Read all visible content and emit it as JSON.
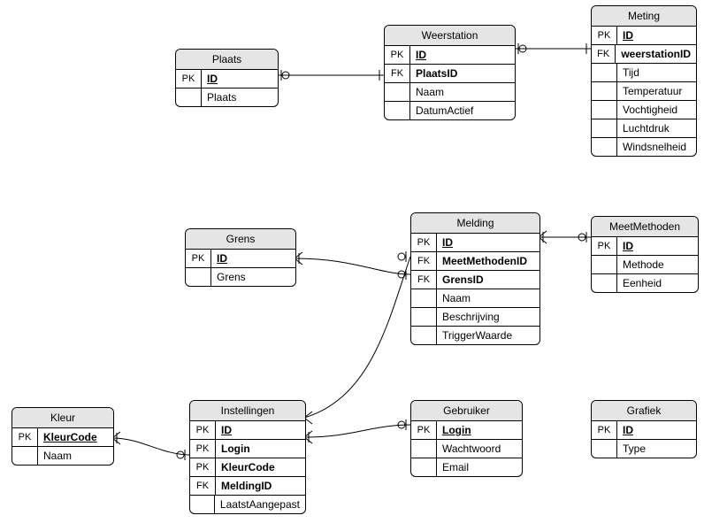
{
  "entities": {
    "plaats": {
      "title": "Plaats",
      "rows": [
        {
          "key": "PK",
          "name": "ID",
          "pk": true
        },
        {
          "key": "",
          "name": "Plaats"
        }
      ]
    },
    "weerstation": {
      "title": "Weerstation",
      "rows": [
        {
          "key": "PK",
          "name": "ID",
          "pk": true
        },
        {
          "key": "FK",
          "name": "PlaatsID",
          "fk": true
        },
        {
          "key": "",
          "name": "Naam"
        },
        {
          "key": "",
          "name": "DatumActief"
        }
      ]
    },
    "meting": {
      "title": "Meting",
      "rows": [
        {
          "key": "PK",
          "name": "ID",
          "pk": true
        },
        {
          "key": "FK",
          "name": "weerstationID",
          "fk": true
        },
        {
          "key": "",
          "name": "Tijd"
        },
        {
          "key": "",
          "name": "Temperatuur"
        },
        {
          "key": "",
          "name": "Vochtigheid"
        },
        {
          "key": "",
          "name": "Luchtdruk"
        },
        {
          "key": "",
          "name": "Windsnelheid"
        }
      ]
    },
    "grens": {
      "title": "Grens",
      "rows": [
        {
          "key": "PK",
          "name": "ID",
          "pk": true
        },
        {
          "key": "",
          "name": "Grens"
        }
      ]
    },
    "melding": {
      "title": "Melding",
      "rows": [
        {
          "key": "PK",
          "name": "ID",
          "pk": true
        },
        {
          "key": "FK",
          "name": "MeetMethodenID",
          "fk": true
        },
        {
          "key": "FK",
          "name": "GrensID",
          "fk": true
        },
        {
          "key": "",
          "name": "Naam"
        },
        {
          "key": "",
          "name": "Beschrijving"
        },
        {
          "key": "",
          "name": "TriggerWaarde"
        }
      ]
    },
    "meetmethoden": {
      "title": "MeetMethoden",
      "rows": [
        {
          "key": "PK",
          "name": "ID",
          "pk": true
        },
        {
          "key": "",
          "name": "Methode"
        },
        {
          "key": "",
          "name": "Eenheid"
        }
      ]
    },
    "kleur": {
      "title": "Kleur",
      "rows": [
        {
          "key": "PK",
          "name": "KleurCode",
          "pk": true
        },
        {
          "key": "",
          "name": "Naam"
        }
      ]
    },
    "instellingen": {
      "title": "Instellingen",
      "rows": [
        {
          "key": "PK",
          "name": "ID",
          "pk": true
        },
        {
          "key": "PK",
          "name": "Login",
          "fk": true
        },
        {
          "key": "PK",
          "name": "KleurCode",
          "fk": true
        },
        {
          "key": "FK",
          "name": "MeldingID",
          "fk": true
        },
        {
          "key": "",
          "name": "LaatstAangepast"
        }
      ]
    },
    "gebruiker": {
      "title": "Gebruiker",
      "rows": [
        {
          "key": "PK",
          "name": "Login",
          "pk": true
        },
        {
          "key": "",
          "name": "Wachtwoord"
        },
        {
          "key": "",
          "name": "Email"
        }
      ]
    },
    "grafiek": {
      "title": "Grafiek",
      "rows": [
        {
          "key": "PK",
          "name": "ID",
          "pk": true
        },
        {
          "key": "",
          "name": "Type"
        }
      ]
    }
  }
}
